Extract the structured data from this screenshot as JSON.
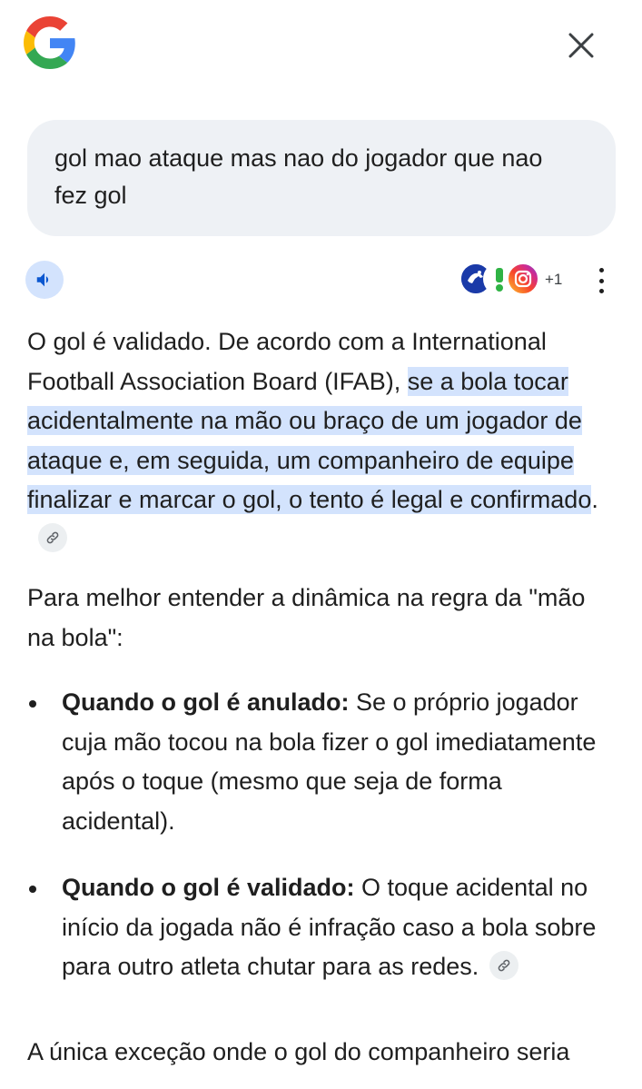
{
  "query": {
    "text": "gol mao ataque mas nao do jogador que nao fez gol"
  },
  "sources": {
    "extra_count": "+1",
    "items": [
      "sports-source-icon",
      "alert-source-icon",
      "instagram-icon"
    ]
  },
  "answer": {
    "p1_plain": "O gol é validado. De acordo com a International Football Association Board (IFAB), ",
    "p1_highlight": "se a bola tocar acidentalmente na mão ou braço de um jogador de ataque e, em seguida, um companheiro de equipe finalizar e marcar o gol, o tento é legal e confirmado",
    "p1_end": ".",
    "p2": "Para melhor entender a dinâmica na regra da \"mão na bola\":",
    "bullets": [
      {
        "title": "Quando o gol é anulado:",
        "text": " Se o próprio jogador cuja mão tocou na bola fizer o gol imediatamente após o toque (mesmo que seja de forma acidental)."
      },
      {
        "title": "Quando o gol é validado:",
        "text": " O toque acidental no início da jogada não é infração caso a bola sobre para outro atleta chutar para as redes."
      }
    ],
    "p3": "A única exceção onde o gol do companheiro seria"
  },
  "colors": {
    "highlight": "#d3e3fd",
    "bubble": "#eef1f5",
    "speaker_bg": "#d3e3fd",
    "accent_blue": "#0b57d0"
  }
}
